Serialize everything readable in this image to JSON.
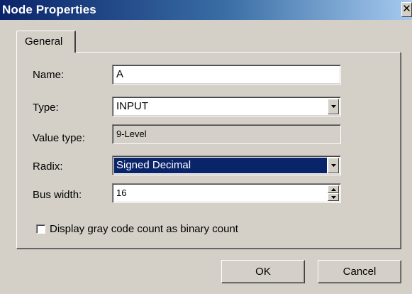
{
  "window": {
    "title": "Node Properties",
    "close_glyph": "✕",
    "close_icon": "close-icon"
  },
  "tabs": [
    {
      "label": "General",
      "selected": true
    }
  ],
  "form": {
    "name": {
      "label": "Name:",
      "value": "A"
    },
    "type": {
      "label": "Type:",
      "value": "INPUT",
      "control": "dropdown"
    },
    "value_type": {
      "label": "Value type:",
      "value": "9-Level",
      "readonly": true
    },
    "radix": {
      "label": "Radix:",
      "value": "Signed Decimal",
      "control": "dropdown",
      "focused": true
    },
    "bus_width": {
      "label": "Bus width:",
      "value": "16",
      "control": "spinner"
    }
  },
  "options": {
    "gray_code": {
      "label": "Display gray code count as binary count",
      "checked": false
    }
  },
  "buttons": {
    "ok": "OK",
    "cancel": "Cancel"
  },
  "colors": {
    "window_bg": "#d4d0c8",
    "title_gradient_start": "#0a246a",
    "title_gradient_end": "#a6caf0",
    "selection": "#0a246a"
  }
}
